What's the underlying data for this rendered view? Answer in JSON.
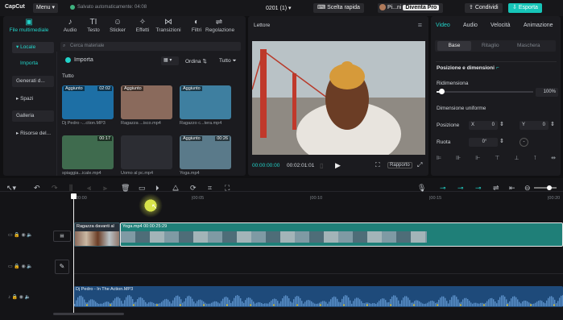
{
  "titlebar": {
    "logo": "CapCut",
    "menu": "Menu",
    "save_status": "Salvato automaticamente: 04:08",
    "project": "0201 (1)",
    "shortcuts": "Scelta rapida",
    "user": "Pi...ni",
    "pro": "Diventa Pro",
    "share": "Condividi",
    "export": "Esporta"
  },
  "toolbar": {
    "items": [
      {
        "label": "File multimediale",
        "icon": "media-icon"
      },
      {
        "label": "Audio",
        "icon": "audio-icon"
      },
      {
        "label": "Testo",
        "icon": "text-icon"
      },
      {
        "label": "Sticker",
        "icon": "sticker-icon"
      },
      {
        "label": "Effetti",
        "icon": "effects-icon"
      },
      {
        "label": "Transizioni",
        "icon": "transitions-icon"
      },
      {
        "label": "Filtri",
        "icon": "filters-icon"
      },
      {
        "label": "Regolazione",
        "icon": "adjust-icon"
      }
    ]
  },
  "sidebar": {
    "items": [
      "Locale",
      "Importa",
      "Generati d...",
      "Spazi",
      "Galleria",
      "Risorse del..."
    ]
  },
  "media": {
    "search_placeholder": "Cerca materiale",
    "import": "Importa",
    "sort": "Ordina",
    "filter": "Tutto",
    "section": "Tutto",
    "items": [
      {
        "badge": "Aggiunto",
        "duration": "02:02",
        "caption": "Dj Pedro -...ction.MP3",
        "color": "#1d6fa5"
      },
      {
        "badge": "Aggiunto",
        "duration": "",
        "caption": "Ragazza ...isco.mp4",
        "color": "#8a6a5c"
      },
      {
        "badge": "Aggiunto",
        "duration": "",
        "caption": "Ragazzo c...tera.mp4",
        "color": "#3e7fa0"
      },
      {
        "badge": "",
        "duration": "00:17",
        "caption": "spiaggia...icale.mp4",
        "color": "#3f6b4e"
      },
      {
        "badge": "",
        "duration": "",
        "caption": "Uomo al pc.mp4",
        "color": "#2c2d33"
      },
      {
        "badge": "Aggiunto",
        "duration": "00:26",
        "caption": "Yoga.mp4",
        "color": "#5a7a8a"
      }
    ]
  },
  "player": {
    "title": "Lettore",
    "current": "00:00:00:00",
    "total": "00:02:01:01",
    "ratio": "Rapporto"
  },
  "inspector": {
    "tabs": [
      "Video",
      "Audio",
      "Velocità",
      "Animazione"
    ],
    "subtabs": [
      "Base",
      "Ritaglio",
      "Maschera"
    ],
    "section": "Posizione e dimensioni",
    "resize": "Ridimensiona",
    "scale_value": "100%",
    "scale_level": 0.05,
    "uniform": "Dimensione uniforme",
    "position": "Posizione",
    "x": "0",
    "y": "0",
    "rotate": "Ruota",
    "angle": "0°"
  },
  "timeline": {
    "ruler": [
      "00:00",
      "|00:05",
      "|00:10",
      "|00:15",
      "|00:20"
    ],
    "clip1_label": "Ragazza davanti al",
    "clip2_label": "Yoga.mp4  00:00:25:29",
    "audio_label": "Dj Pedro - In The Action.MP3"
  },
  "colors": {
    "accent": "#22d3c9",
    "clip": "#1f7f78",
    "audio": "#1e4a7a"
  }
}
